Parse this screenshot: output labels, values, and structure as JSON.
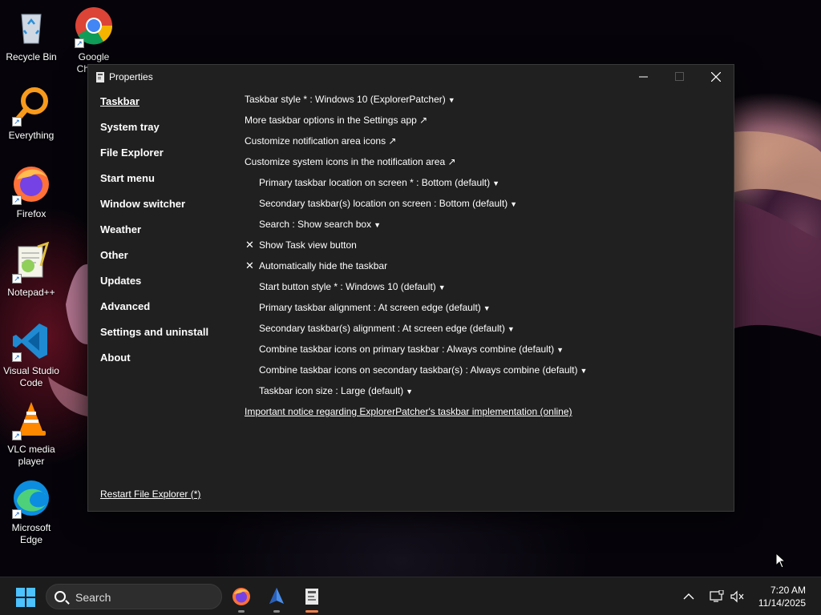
{
  "desktop": {
    "icons": [
      {
        "label": "Recycle Bin"
      },
      {
        "label": "Google Chrome"
      },
      {
        "label": "Everything"
      },
      {
        "label": "Firefox"
      },
      {
        "label": "Notepad++"
      },
      {
        "label": "Visual Studio Code"
      },
      {
        "label": "VLC media player"
      },
      {
        "label": "Microsoft Edge"
      }
    ]
  },
  "window": {
    "title": "Properties",
    "buttons": {
      "minimize": "—",
      "maximize": "☐",
      "close": "✕"
    },
    "sidebar": {
      "items": [
        {
          "label": "Taskbar"
        },
        {
          "label": "System tray"
        },
        {
          "label": "File Explorer"
        },
        {
          "label": "Start menu"
        },
        {
          "label": "Window switcher"
        },
        {
          "label": "Weather"
        },
        {
          "label": "Other"
        },
        {
          "label": "Updates"
        },
        {
          "label": "Advanced"
        },
        {
          "label": "Settings and uninstall"
        },
        {
          "label": "About"
        }
      ],
      "restart_link": "Restart File Explorer (*)"
    },
    "options": [
      {
        "label": "Taskbar style * : Windows 10 (ExplorerPatcher)",
        "suffix": "▼"
      },
      {
        "label": "More taskbar options in the Settings app ↗",
        "suffix": ""
      },
      {
        "label": "Customize notification area icons ↗",
        "suffix": ""
      },
      {
        "label": "Customize system icons in the notification area ↗",
        "suffix": ""
      },
      {
        "label": "Primary taskbar location on screen * : Bottom (default)",
        "suffix": "▼"
      },
      {
        "label": "Secondary taskbar(s) location on screen : Bottom (default)",
        "suffix": "▼"
      },
      {
        "label": "Search : Show search box",
        "suffix": "▼"
      },
      {
        "label": "Show Task view button",
        "check": "✕"
      },
      {
        "label": "Automatically hide the taskbar",
        "check": "✕"
      },
      {
        "label": "Start button style * : Windows 10 (default)",
        "suffix": "▼"
      },
      {
        "label": "Primary taskbar alignment : At screen edge (default)",
        "suffix": "▼"
      },
      {
        "label": "Secondary taskbar(s) alignment : At screen edge (default)",
        "suffix": "▼"
      },
      {
        "label": "Combine taskbar icons on primary taskbar : Always combine (default)",
        "suffix": "▼"
      },
      {
        "label": "Combine taskbar icons on secondary taskbar(s) : Always combine (default)",
        "suffix": "▼"
      },
      {
        "label": "Taskbar icon size : Large (default)",
        "suffix": "▼"
      },
      {
        "label": "Important notice regarding ExplorerPatcher's taskbar implementation (online)",
        "suffix": ""
      }
    ]
  },
  "taskbar": {
    "search_placeholder": "Search",
    "tray_chevron": "^",
    "time": "7:20 AM",
    "date": "11/14/2025"
  },
  "colors": {
    "window_bg": "#202020",
    "accent_start": "#4cc2ff",
    "active_app_indicator": "#f0804a"
  }
}
